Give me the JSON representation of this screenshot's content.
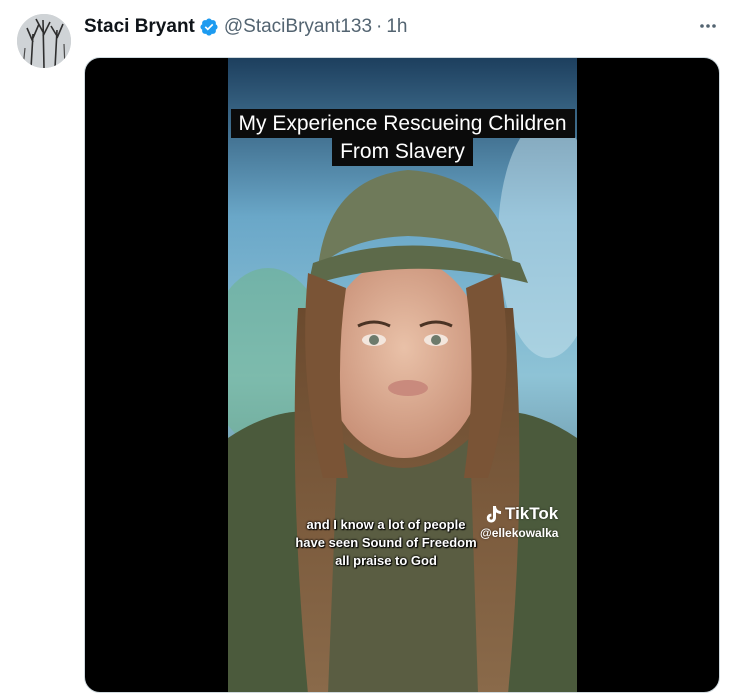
{
  "tweet": {
    "author_name": "Staci Bryant",
    "handle": "@StaciBryant133",
    "separator": "·",
    "time": "1h",
    "verified": true,
    "more_icon": "more-horizontal-icon"
  },
  "video": {
    "title_caption": "My Experience Rescueing Children From Slavery",
    "subtitle_lines": [
      "and I know a lot of people",
      "have seen Sound of Freedom",
      "all praise to God"
    ],
    "watermark_brand": "TikTok",
    "watermark_user": "@ellekowalka"
  },
  "colors": {
    "verified_blue": "#1d9bf0",
    "secondary_text": "#536471",
    "caption_bg": "#0b0b0b"
  }
}
